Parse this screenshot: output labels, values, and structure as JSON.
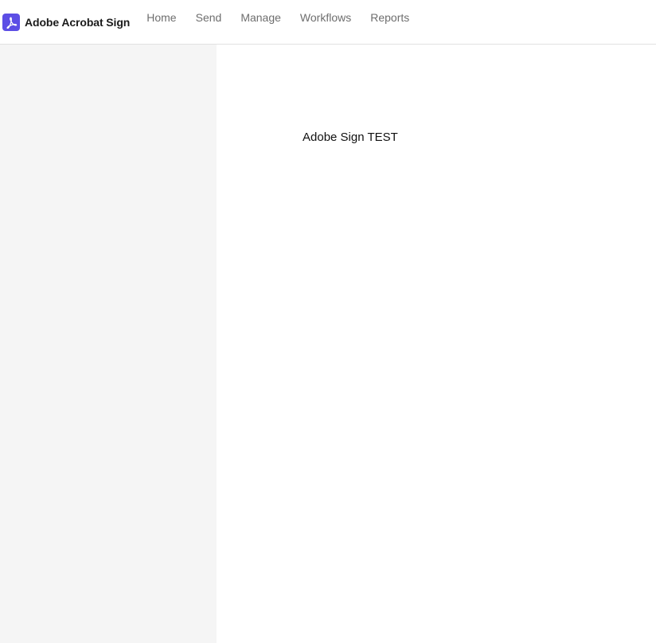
{
  "header": {
    "brand": {
      "icon": "acrobat-logo-icon",
      "name": "Adobe Acrobat Sign",
      "logo_color": "#5c4ee5"
    },
    "nav": [
      {
        "label": "Home"
      },
      {
        "label": "Send"
      },
      {
        "label": "Manage"
      },
      {
        "label": "Workflows"
      },
      {
        "label": "Reports"
      }
    ]
  },
  "sidebar": {
    "background": "#f5f5f5"
  },
  "main": {
    "text": "Adobe Sign TEST"
  }
}
